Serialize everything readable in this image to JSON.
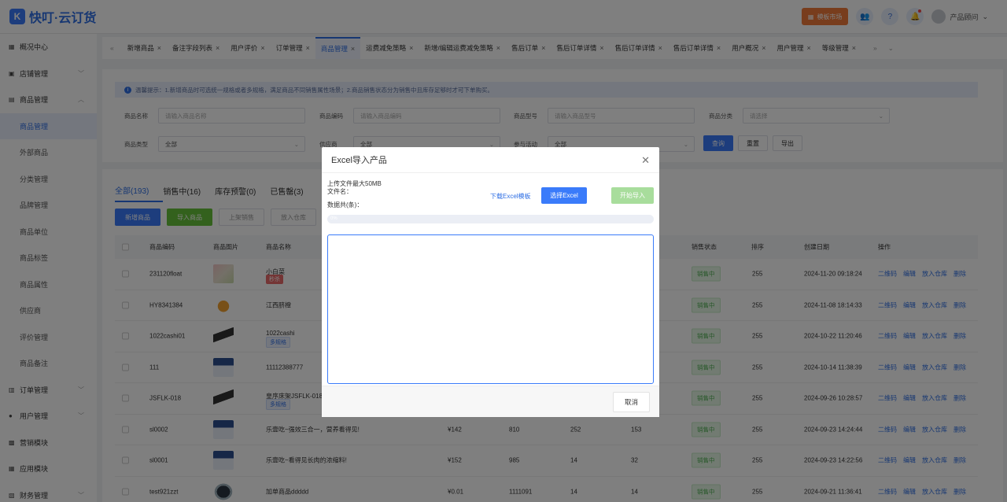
{
  "app": {
    "logo_mark": "K",
    "title": "快叮·云订货"
  },
  "header": {
    "template_market": "模板市场",
    "user_name": "产品顾问"
  },
  "sidebar": {
    "items": [
      {
        "label": "概况中心",
        "icon": "store-icon",
        "expand": false
      },
      {
        "label": "店铺管理",
        "icon": "shop-icon",
        "expand": true
      },
      {
        "label": "商品管理",
        "icon": "box-icon",
        "expand": true,
        "open": true
      },
      {
        "label": "订单管理",
        "icon": "order-icon",
        "expand": true
      },
      {
        "label": "用户管理",
        "icon": "user-icon",
        "expand": true
      },
      {
        "label": "营销模块",
        "icon": "marketing-icon",
        "expand": false
      },
      {
        "label": "应用模块",
        "icon": "apps-icon",
        "expand": false
      },
      {
        "label": "财务管理",
        "icon": "finance-icon",
        "expand": true
      }
    ],
    "sub_items": [
      "商品管理",
      "外部商品",
      "分类管理",
      "品牌管理",
      "商品单位",
      "商品标签",
      "商品属性",
      "供应商",
      "评价管理",
      "商品备注"
    ]
  },
  "tabs": [
    "新增商品",
    "备注字段列表",
    "用户评价",
    "订单管理",
    "商品管理",
    "运费减免策略",
    "新增/编辑运费减免策略",
    "售后订单",
    "售后订单详情",
    "售后订单详情",
    "售后订单详情",
    "用户概况",
    "用户管理",
    "等级管理"
  ],
  "active_tab_index": 4,
  "tip": "温馨提示：1.新增商品时可选统一规格或者多规格，满足商品不同销售属性场景；2.商品销售状态分为销售中且库存足够时才可下单购买。",
  "filters": {
    "product_name_label": "商品名称",
    "product_name_ph": "请输入商品名称",
    "product_code_label": "商品编码",
    "product_code_ph": "请输入商品编码",
    "product_model_label": "商品型号",
    "product_model_ph": "请输入商品型号",
    "category_label": "商品分类",
    "category_ph": "请选择",
    "type_label": "商品类型",
    "type_value": "全部",
    "supplier_label": "供应商",
    "supplier_value": "全部",
    "activity_label": "参与活动",
    "activity_value": "全部",
    "query": "查询",
    "reset": "重置",
    "export": "导出"
  },
  "status_tabs": [
    "全部(193)",
    "销售中(16)",
    "库存预警(0)",
    "已售罄(3)"
  ],
  "action_buttons": [
    "新增商品",
    "导入商品",
    "上架销售",
    "放入仓库"
  ],
  "table": {
    "headers": {
      "code": "商品编码",
      "image": "商品图片",
      "name": "商品名称",
      "status": "销售状态",
      "sort": "排序",
      "created": "创建日期",
      "ops": "操作"
    },
    "ops": [
      "二维码",
      "编辑",
      "放入仓库",
      "删除"
    ],
    "rows": [
      {
        "code": "231120float",
        "name": "小白菜",
        "tag": "秒杀",
        "tag_type": "red",
        "price": "",
        "c1": "",
        "c2": "",
        "c3": "",
        "status": "销售中",
        "sort": "255",
        "created": "2024-11-20 09:18:24",
        "img": "veg"
      },
      {
        "code": "HY8341384",
        "name": "江西脐橙",
        "tag": "",
        "tag_type": "",
        "price": "",
        "c1": "",
        "c2": "",
        "c3": "",
        "status": "销售中",
        "sort": "255",
        "created": "2024-11-08 18:14:33",
        "img": "orange"
      },
      {
        "code": "1022cashi01",
        "name": "1022cashi",
        "tag": "多规格",
        "tag_type": "blue",
        "price": "",
        "c1": "",
        "c2": "",
        "c3": "",
        "status": "销售中",
        "sort": "255",
        "created": "2024-10-22 11:20:46",
        "img": "dark"
      },
      {
        "code": "111",
        "name": "11112388777",
        "tag": "",
        "tag_type": "",
        "price": "",
        "c1": "",
        "c2": "",
        "c3": "",
        "status": "销售中",
        "sort": "255",
        "created": "2024-10-14 11:38:39",
        "img": "milk"
      },
      {
        "code": "JSFLK-018",
        "name": "皇序床架JSFLK-018",
        "tag": "多规格",
        "tag_type": "blue",
        "price": "",
        "c1": "",
        "c2": "",
        "c3": "",
        "status": "销售中",
        "sort": "255",
        "created": "2024-09-26 10:28:57",
        "img": "dark"
      },
      {
        "code": "sl0002",
        "name": "乐壹吃~强效三合一，营养看得见!",
        "tag": "",
        "tag_type": "",
        "price": "¥142",
        "c1": "810",
        "c2": "252",
        "c3": "153",
        "status": "销售中",
        "sort": "255",
        "created": "2024-09-23 14:24:44",
        "img": "milk"
      },
      {
        "code": "sl0001",
        "name": "乐壹吃~看得见长肉的浓缩料!",
        "tag": "",
        "tag_type": "",
        "price": "¥152",
        "c1": "985",
        "c2": "14",
        "c3": "32",
        "status": "销售中",
        "sort": "255",
        "created": "2024-09-23 14:22:56",
        "img": "milk"
      },
      {
        "code": "test921zzt",
        "name": "加单商品ddddd",
        "tag": "",
        "tag_type": "",
        "price": "¥0.01",
        "c1": "1111091",
        "c2": "14",
        "c3": "14",
        "status": "销售中",
        "sort": "255",
        "created": "2024-09-21 11:36:41",
        "img": "tv"
      }
    ]
  },
  "modal": {
    "title": "Excel导入产品",
    "max_size": "上传文件最大50MB",
    "file_name": "文件名：",
    "data_count": "数据共(条)：",
    "download_template": "下载Excel模板",
    "choose_excel": "选择Excel",
    "start_import": "开始导入",
    "progress": 0,
    "progress_text": "0%",
    "cancel": "取消"
  }
}
